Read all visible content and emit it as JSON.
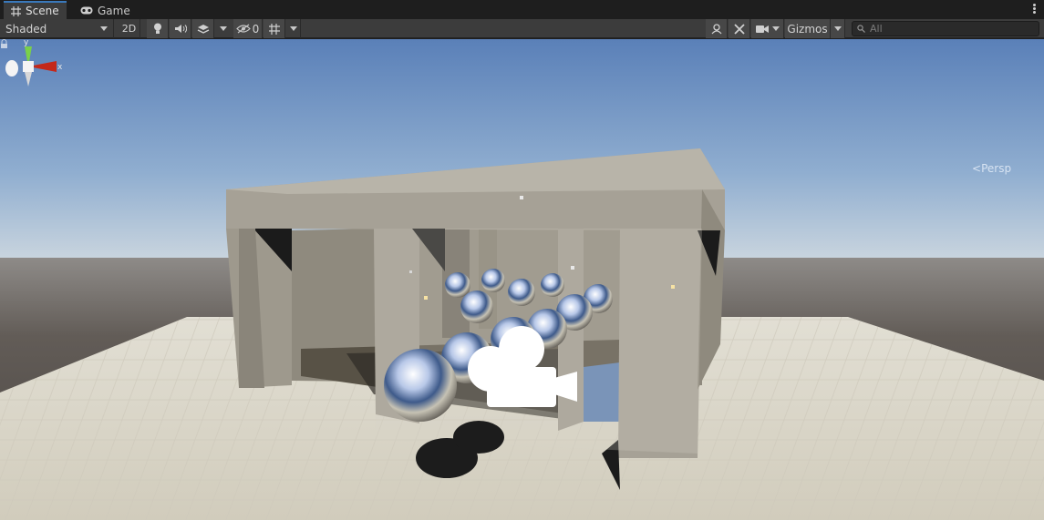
{
  "tabs": [
    {
      "label": "Scene",
      "icon": "grid-icon",
      "active": true
    },
    {
      "label": "Game",
      "icon": "gamepad-icon",
      "active": false
    }
  ],
  "toolbar": {
    "draw_mode": "Shaded",
    "toggle_2d": "2D",
    "hidden_count": "0",
    "gizmos_label": "Gizmos",
    "search_placeholder": "All"
  },
  "viewport": {
    "projection_label": "Persp",
    "axis_y": "y",
    "axis_x": "x"
  },
  "colors": {
    "sky_top": "#5a80b8",
    "sky_horizon": "#c7d3de",
    "ground": "#5c5652",
    "floor": "#dcd8cc",
    "frame": "#a29d92",
    "accent_tab": "#3a79bb"
  }
}
